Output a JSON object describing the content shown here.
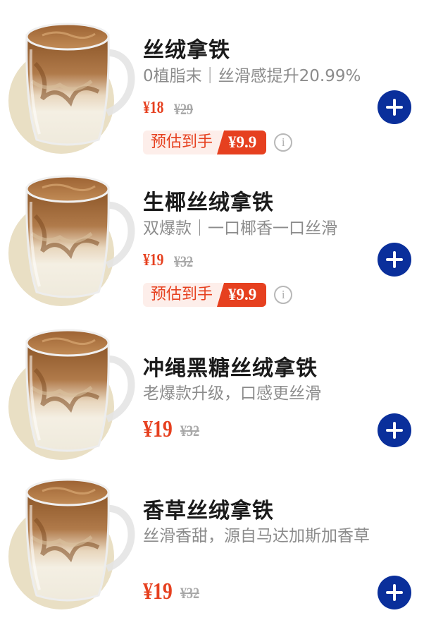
{
  "products": [
    {
      "name": "丝绒拿铁",
      "desc": "0植脂末｜丝滑感提升20.99%",
      "price": "¥18",
      "orig_price": "¥29",
      "est_label": "预估到手",
      "est_price": "¥9.9"
    },
    {
      "name": "生椰丝绒拿铁",
      "desc": "双爆款｜一口椰香一口丝滑",
      "price": "¥19",
      "orig_price": "¥32",
      "est_label": "预估到手",
      "est_price": "¥9.9"
    },
    {
      "name": "冲绳黑糖丝绒拿铁",
      "desc": "老爆款升级，口感更丝滑",
      "price": "¥19",
      "orig_price": "¥32"
    },
    {
      "name": "香草丝绒拿铁",
      "desc": "丝滑香甜，源自马达加斯加香草",
      "price": "¥19",
      "orig_price": "¥32"
    }
  ],
  "icons": {
    "add": "plus-icon",
    "info": "info-icon"
  },
  "colors": {
    "accent_red": "#e6401f",
    "add_button_blue": "#0a2f9b",
    "saucer": "#e9dfc4"
  }
}
